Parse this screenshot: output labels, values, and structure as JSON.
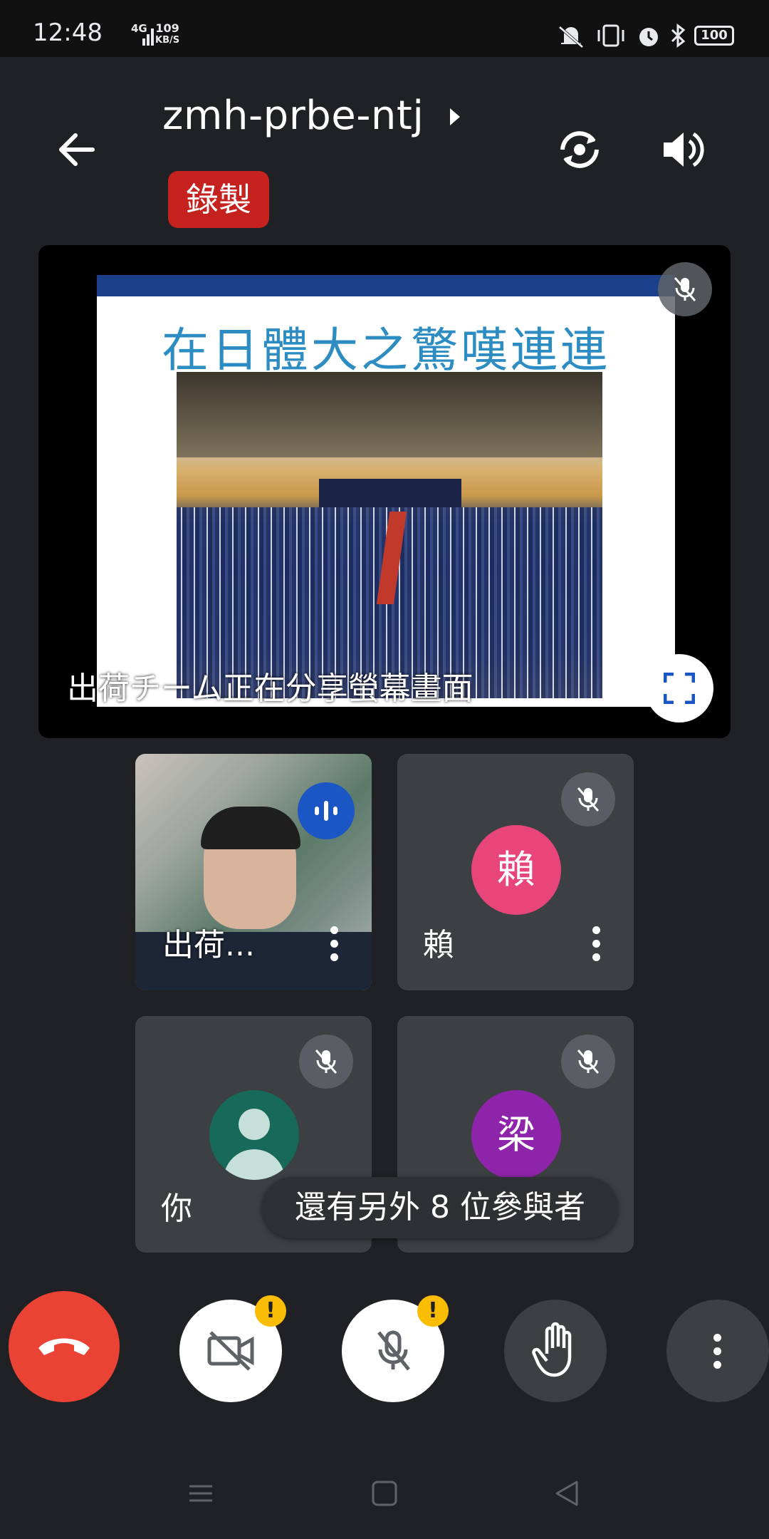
{
  "status_bar": {
    "time": "12:48",
    "network": "4G",
    "speed_value": "109",
    "speed_unit": "KB/S",
    "battery": "100"
  },
  "header": {
    "meeting_code": "zmh-prbe-ntj",
    "recording_label": "錄製"
  },
  "presentation": {
    "slide_title": "在日體大之驚嘆連連",
    "caption": "出荷チーム正在分享螢幕畫面"
  },
  "participants": [
    {
      "name": "出荷...",
      "initial": "",
      "avatar_color": "",
      "speaking": true
    },
    {
      "name": "賴",
      "initial": "賴",
      "avatar_color": "#e8457a",
      "muted": true
    },
    {
      "name": "你",
      "initial": "",
      "avatar_color": "#17695a",
      "muted": true
    },
    {
      "name": "梁",
      "initial": "梁",
      "avatar_color": "#8e24aa",
      "muted": true
    }
  ],
  "more_participants": "還有另外 8 位參與者",
  "controls": {
    "end_call": "end-call",
    "camera": "camera-off",
    "mic": "mic-off",
    "raise_hand": "raise-hand",
    "more": "more-options",
    "warning_glyph": "!"
  },
  "colors": {
    "background": "#202124",
    "end_call": "#ea4335",
    "recording": "#c5221f",
    "warning": "#fbbc04",
    "speaking": "#1a56c4"
  }
}
